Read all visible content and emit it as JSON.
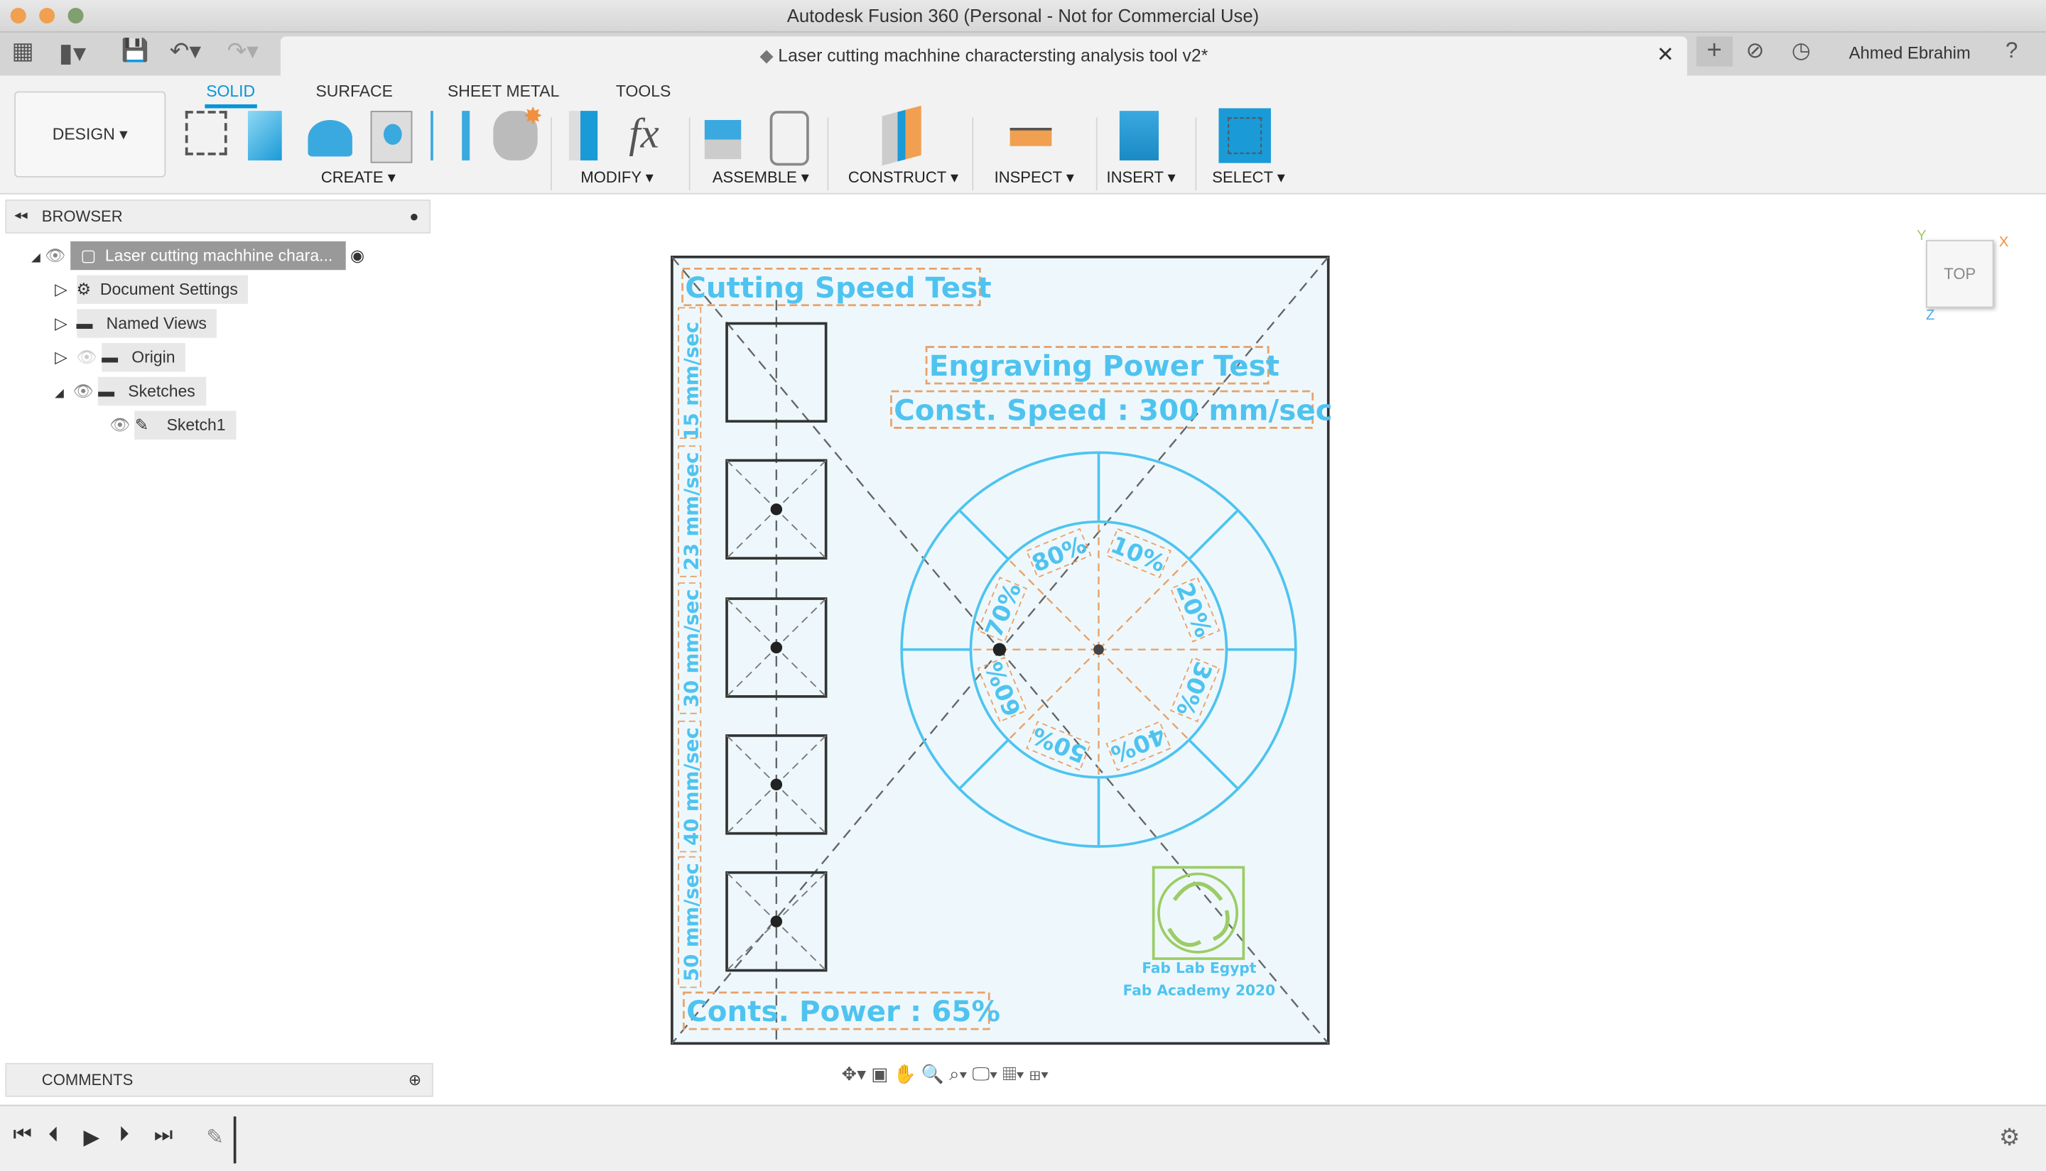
{
  "window": {
    "title": "Autodesk Fusion 360 (Personal - Not for Commercial Use)"
  },
  "document_tab": {
    "title": "Laser cutting machhine charactersting analysis tool v2*"
  },
  "user": {
    "name": "Ahmed Ebrahim"
  },
  "workspace": {
    "label": "DESIGN"
  },
  "toolbar": {
    "tabs": [
      {
        "label": "SOLID",
        "active": true
      },
      {
        "label": "SURFACE"
      },
      {
        "label": "SHEET METAL"
      },
      {
        "label": "TOOLS"
      }
    ],
    "groups": [
      "CREATE",
      "MODIFY",
      "ASSEMBLE",
      "CONSTRUCT",
      "INSPECT",
      "INSERT",
      "SELECT"
    ]
  },
  "browser": {
    "title": "BROWSER",
    "root": "Laser cutting machhine chara...",
    "items": [
      "Document Settings",
      "Named Views",
      "Origin",
      "Sketches",
      "Sketch1"
    ]
  },
  "comments": {
    "title": "COMMENTS"
  },
  "viewcube": {
    "face": "TOP",
    "axes": [
      "X",
      "Y",
      "Z"
    ]
  },
  "sketch": {
    "cut_title": "Cutting Speed Test",
    "engrave_title": "Engraving Power Test",
    "const_speed": "Const. Speed : 300 mm/sec",
    "const_power": "Conts. Power : 65%",
    "speeds": [
      "15 mm/sec",
      "23 mm/sec",
      "30 mm/sec",
      "40 mm/sec",
      "50 mm/sec"
    ],
    "powers": [
      "10%",
      "20%",
      "30%",
      "40%",
      "50%",
      "60%",
      "70%",
      "80%"
    ],
    "logo_line1": "Fab Lab Egypt",
    "logo_line2": "Fab Academy 2020"
  },
  "colors": {
    "accent": "#0696d7",
    "sketch_text": "#4fc3ef",
    "dim": "#e8a26a",
    "logo": "#9ccc65",
    "sketch_bg": "#eef8fc"
  }
}
